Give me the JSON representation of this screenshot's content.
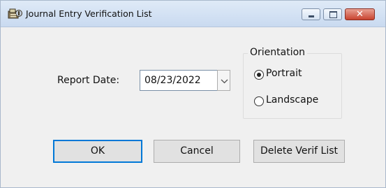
{
  "window": {
    "title": "Journal Entry Verification List",
    "close_glyph": "✕",
    "icons": [
      "app-icon",
      "minimize-icon",
      "maximize-icon",
      "close-icon"
    ]
  },
  "form": {
    "report_date_label": "Report Date:",
    "report_date_value": "08/23/2022",
    "orientation": {
      "legend": "Orientation",
      "options": [
        {
          "label": "Portrait",
          "selected": true
        },
        {
          "label": "Landscape",
          "selected": false
        }
      ]
    }
  },
  "buttons": {
    "ok": "OK",
    "cancel": "Cancel",
    "delete": "Delete Verif List"
  },
  "colors": {
    "accent_focus": "#0078d7",
    "close_button": "#c8432f"
  }
}
